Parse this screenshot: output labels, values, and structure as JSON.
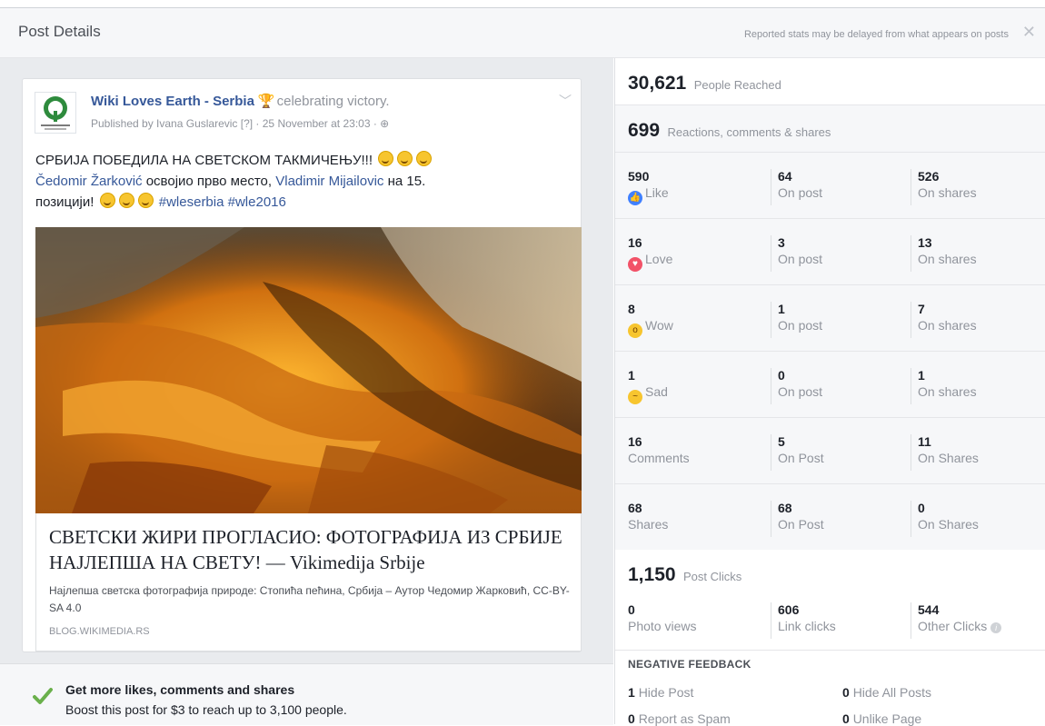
{
  "header": {
    "title": "Post Details",
    "note": "Reported stats may be delayed from what appears on posts",
    "close": "✕"
  },
  "post": {
    "page_name": "Wiki Loves Earth - Serbia",
    "activity": "celebrating victory.",
    "published": "Published by Ivana Guslarevic [?] · 25 November at 23:03 · ",
    "text_line1": "СРБИЈА ПОБЕДИЛА НА СВЕТСКОМ ТАКМИЧЕЊУ!!!",
    "mention1": "Čedomir Žarković",
    "text_line2": "освојио прво место,",
    "mention2": "Vladimir Mijailovic",
    "text_line2b": "на 15.",
    "text_line3": "позицији!",
    "hashtags": "#wleserbia #wle2016",
    "link_title": "СВЕТСКИ ЖИРИ ПРОГЛАСИО: ФОТОГРАФИЈА ИЗ СРБИЈЕ НАЈЛЕПША НА СВЕТУ! — Vikimedija Srbije",
    "link_desc": "Најлепша светска фотографија природе: Стопића пећина, Србија – Аутор Чедомир Жарковић, CC-BY-SA 4.0",
    "link_domain": "BLOG.WIKIMEDIA.RS"
  },
  "boost": {
    "title": "Get more likes, comments and shares",
    "desc": "Boost this post for $3 to reach up to 3,100 people."
  },
  "stats": {
    "reach_value": "30,621",
    "reach_label": "People Reached",
    "engage_value": "699",
    "engage_label": "Reactions, comments & shares",
    "rows": [
      {
        "total": "590",
        "label": "Like",
        "on_post": "64",
        "on_post_label": "On post",
        "on_shares": "526",
        "on_shares_label": "On shares"
      },
      {
        "total": "16",
        "label": "Love",
        "on_post": "3",
        "on_post_label": "On post",
        "on_shares": "13",
        "on_shares_label": "On shares"
      },
      {
        "total": "8",
        "label": "Wow",
        "on_post": "1",
        "on_post_label": "On post",
        "on_shares": "7",
        "on_shares_label": "On shares"
      },
      {
        "total": "1",
        "label": "Sad",
        "on_post": "0",
        "on_post_label": "On post",
        "on_shares": "1",
        "on_shares_label": "On shares"
      },
      {
        "total": "16",
        "label": "Comments",
        "on_post": "5",
        "on_post_label": "On Post",
        "on_shares": "11",
        "on_shares_label": "On Shares"
      },
      {
        "total": "68",
        "label": "Shares",
        "on_post": "68",
        "on_post_label": "On Post",
        "on_shares": "0",
        "on_shares_label": "On Shares"
      }
    ],
    "clicks_value": "1,150",
    "clicks_label": "Post Clicks",
    "photo_views": "0",
    "photo_views_label": "Photo views",
    "link_clicks": "606",
    "link_clicks_label": "Link clicks",
    "other_clicks": "544",
    "other_clicks_label": "Other Clicks",
    "negative_title": "NEGATIVE FEEDBACK",
    "hide_post_value": "1",
    "hide_post_label": "Hide Post",
    "hide_all_value": "0",
    "hide_all_label": "Hide All Posts",
    "spam_value": "0",
    "spam_label": "Report as Spam",
    "unlike_value": "0",
    "unlike_label": "Unlike Page"
  },
  "colors": {
    "link": "#365899",
    "like": "#4080ff",
    "love": "#f25268",
    "wow": "#f7c52f"
  }
}
